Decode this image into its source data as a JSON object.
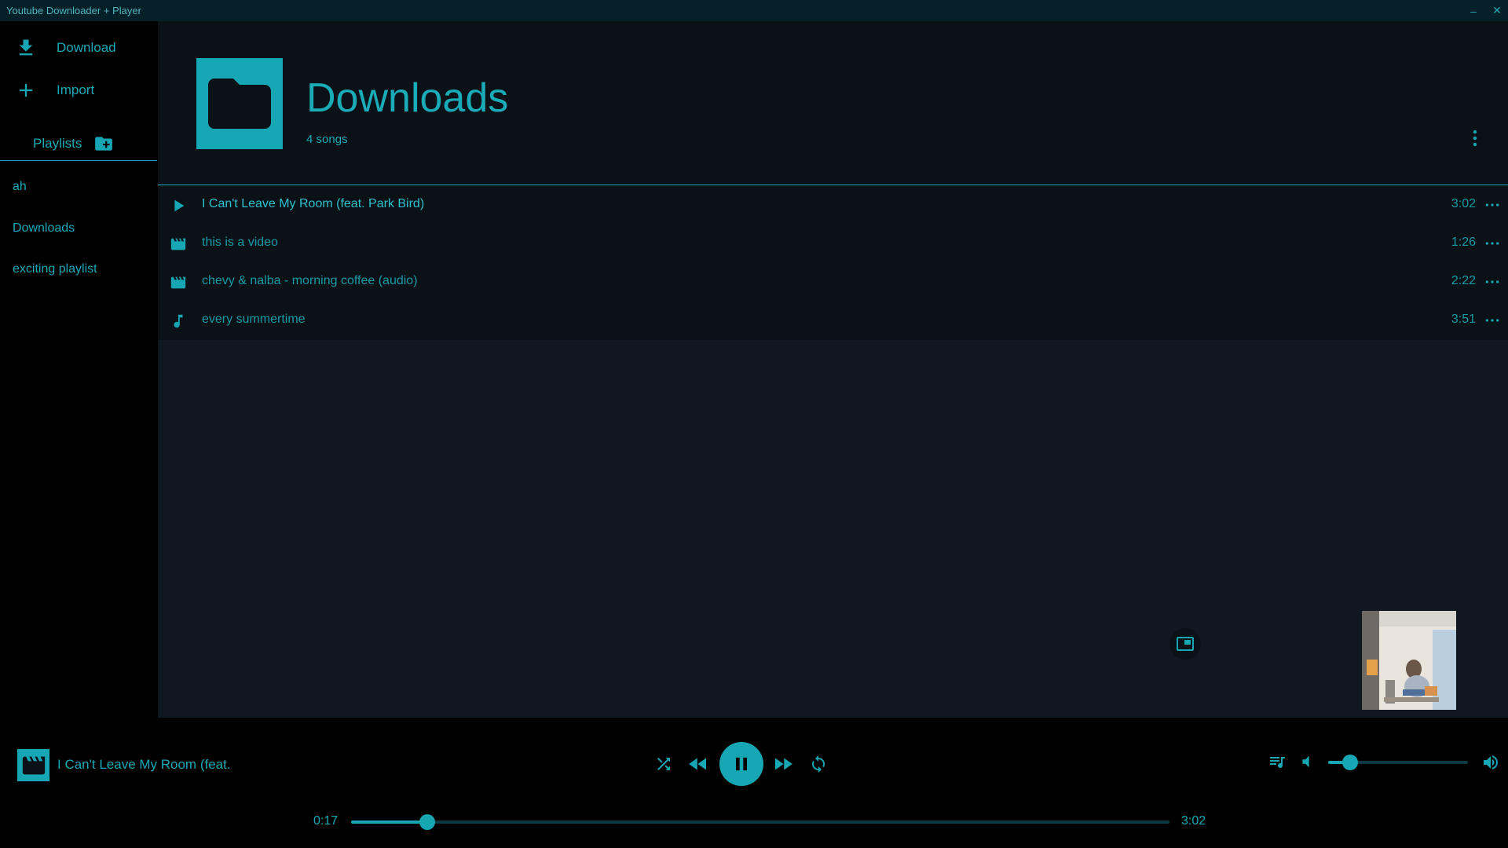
{
  "window": {
    "title": "Youtube Downloader + Player",
    "minimize_glyph": "–",
    "close_glyph": "✕"
  },
  "sidebar": {
    "actions": [
      {
        "label": "Download",
        "icon": "download-icon"
      },
      {
        "label": "Import",
        "icon": "plus-icon"
      }
    ],
    "playlists_header": "Playlists",
    "playlists": [
      {
        "label": "ah"
      },
      {
        "label": "Downloads"
      },
      {
        "label": "exciting playlist"
      }
    ]
  },
  "playlist": {
    "title": "Downloads",
    "count": "4 songs",
    "songs": [
      {
        "title": "I Can't Leave My Room (feat. Park Bird)",
        "duration": "3:02",
        "icon": "play-icon",
        "playing": true
      },
      {
        "title": "this is a video",
        "duration": "1:26",
        "icon": "movie-icon"
      },
      {
        "title": "chevy & nalba - morning coffee (audio)",
        "duration": "2:22",
        "icon": "movie-icon"
      },
      {
        "title": "every summertime",
        "duration": "3:51",
        "icon": "music-note-icon"
      }
    ]
  },
  "player": {
    "now_playing": "I Can't Leave My Room (feat.",
    "elapsed": "0:17",
    "total": "3:02",
    "progress_fraction": 0.093,
    "volume_fraction": 0.16
  },
  "colors": {
    "accent": "#17a6b3",
    "background": "#000000",
    "panel": "#0b1217",
    "main": "#0f1820"
  }
}
